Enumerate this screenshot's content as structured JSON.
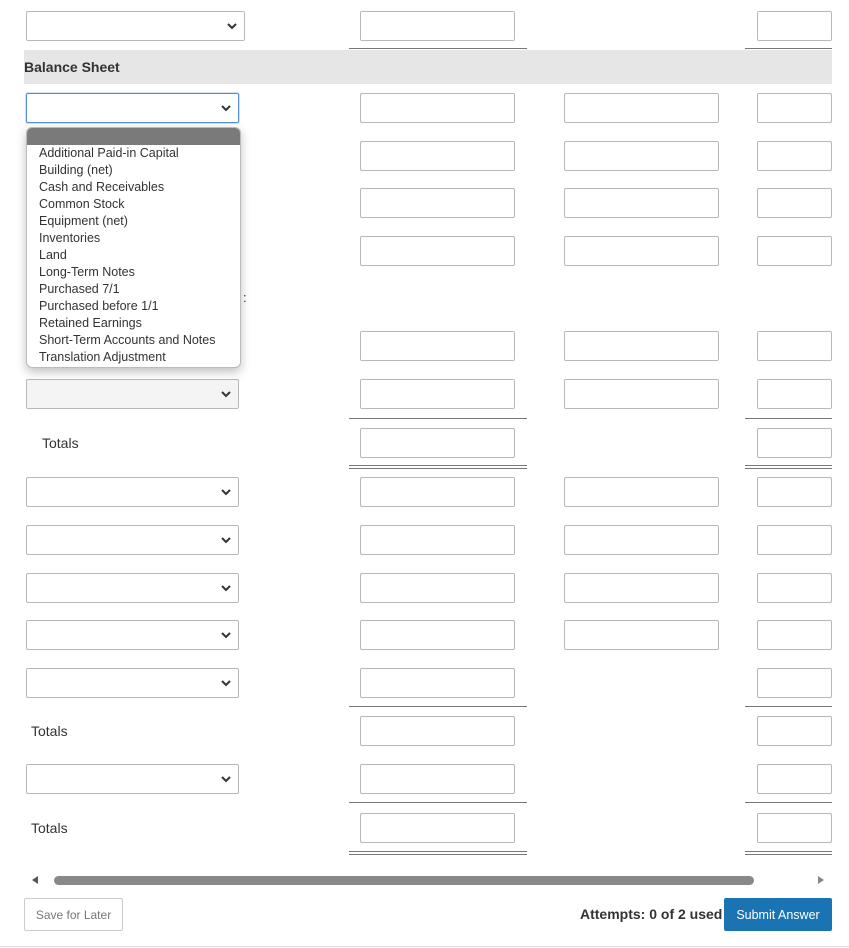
{
  "section_title": "Balance Sheet",
  "dropdown_options": [
    "Additional Paid-in Capital",
    "Building (net)",
    "Cash and Receivables",
    "Common Stock",
    "Equipment (net)",
    "Inventories",
    "Land",
    "Long-Term Notes",
    "Purchased 7/1",
    "Purchased before 1/1",
    "Retained Earnings",
    "Short-Term Accounts and Notes",
    "Translation Adjustment"
  ],
  "colon_text": ":",
  "totals_labels": [
    "Totals",
    "Totals",
    "Totals"
  ],
  "footer": {
    "save_label": "Save for Later",
    "attempts_label": "Attempts: 0 of 2 used",
    "submit_label": "Submit Answer"
  },
  "colors": {
    "submit": "#1a74b3",
    "section_bg": "#e6e6e6",
    "input_border": "#b8b8b8"
  }
}
